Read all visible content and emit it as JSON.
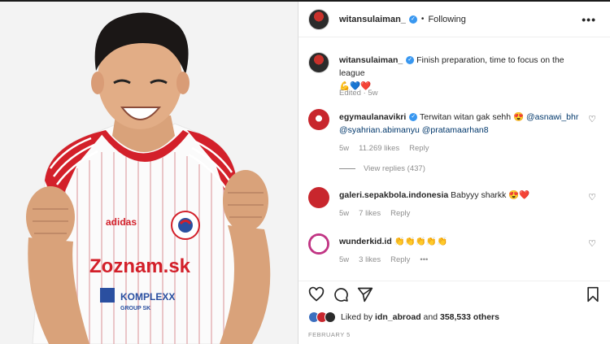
{
  "post": {
    "author": "witansulaiman_",
    "follow_status": "Following",
    "dot": "•",
    "more": "•••"
  },
  "caption": {
    "author": "witansulaiman_",
    "text": "Finish preparation, time to focus on the league",
    "emojis": "💪💙❤️",
    "edited": "Edited · 5w"
  },
  "comments": [
    {
      "user": "egymaulanavikri",
      "verified": true,
      "text_prefix": "Terwitan witan gak sehh 😍 ",
      "mention1": "@asnawi_bhr",
      "mention2": "@syahrian.abimanyu",
      "mention3": "@pratamaarhan8",
      "time": "5w",
      "likes": "11.269 likes",
      "reply": "Reply",
      "view_replies": "View replies (437)"
    },
    {
      "user": "galeri.sepakbola.indonesia",
      "text": "Babyyy sharkk 😍❤️",
      "time": "5w",
      "likes": "7 likes",
      "reply": "Reply"
    },
    {
      "user": "wunderkid.id",
      "text": "👏👏👏👏👏",
      "time": "5w",
      "likes": "3 likes",
      "reply": "Reply",
      "more": "•••"
    }
  ],
  "footer": {
    "liked_by_prefix": "Liked by",
    "liked_by_user": "idn_abroad",
    "and_text": "and",
    "others": "358,533 others",
    "date": "FEBRUARY 5"
  },
  "jersey": {
    "sponsor": "Zoznam.sk",
    "sponsor2": "KOMPLEXX",
    "sponsor2_sub": "GROUP SK",
    "brand": "adidas"
  },
  "colors": {
    "jersey_red": "#d3202a",
    "verified_blue": "#3897f0",
    "mention_blue": "#00376b"
  }
}
